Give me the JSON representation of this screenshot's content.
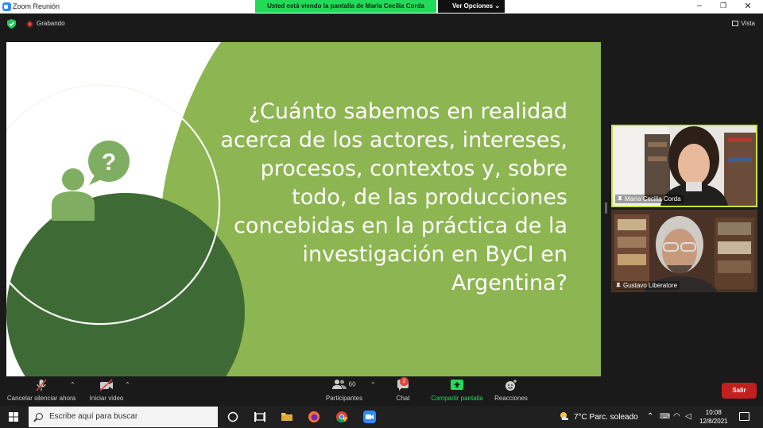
{
  "window": {
    "title": "Zoom Reunión",
    "share_banner": "Usted está viendo la pantalla de María Cecilia Corda",
    "view_options": "Ver Opciones"
  },
  "status": {
    "recording_label": "Grabando",
    "view_label": "Vista"
  },
  "slide": {
    "lines": [
      "¿Cuánto sabemos en realidad",
      "acerca de los actores, intereses,",
      "procesos, contextos y, sobre",
      "todo, de las producciones",
      "concebidas en la práctica de la",
      "investigación en ByCI en",
      "Argentina?"
    ],
    "colors": {
      "green_light": "#8db552",
      "green_dark": "#3e6b35",
      "icon_green": "#7fae63"
    }
  },
  "participants": [
    {
      "name": "María Cecilia Corda",
      "active": true
    },
    {
      "name": "Gustavo Liberatore",
      "active": false
    }
  ],
  "toolbar": {
    "mute_label": "Cancelar silenciar ahora",
    "video_label": "Iniciar video",
    "participants_label": "Participantes",
    "participants_count": "60",
    "chat_label": "Chat",
    "chat_badge": "2",
    "share_label": "Compartir pantalla",
    "reactions_label": "Reacciones",
    "leave_label": "Salir"
  },
  "taskbar": {
    "search_placeholder": "Escribe aquí para buscar",
    "weather": "7°C  Parc. soleado",
    "time": "10:08",
    "date": "12/8/2021"
  }
}
